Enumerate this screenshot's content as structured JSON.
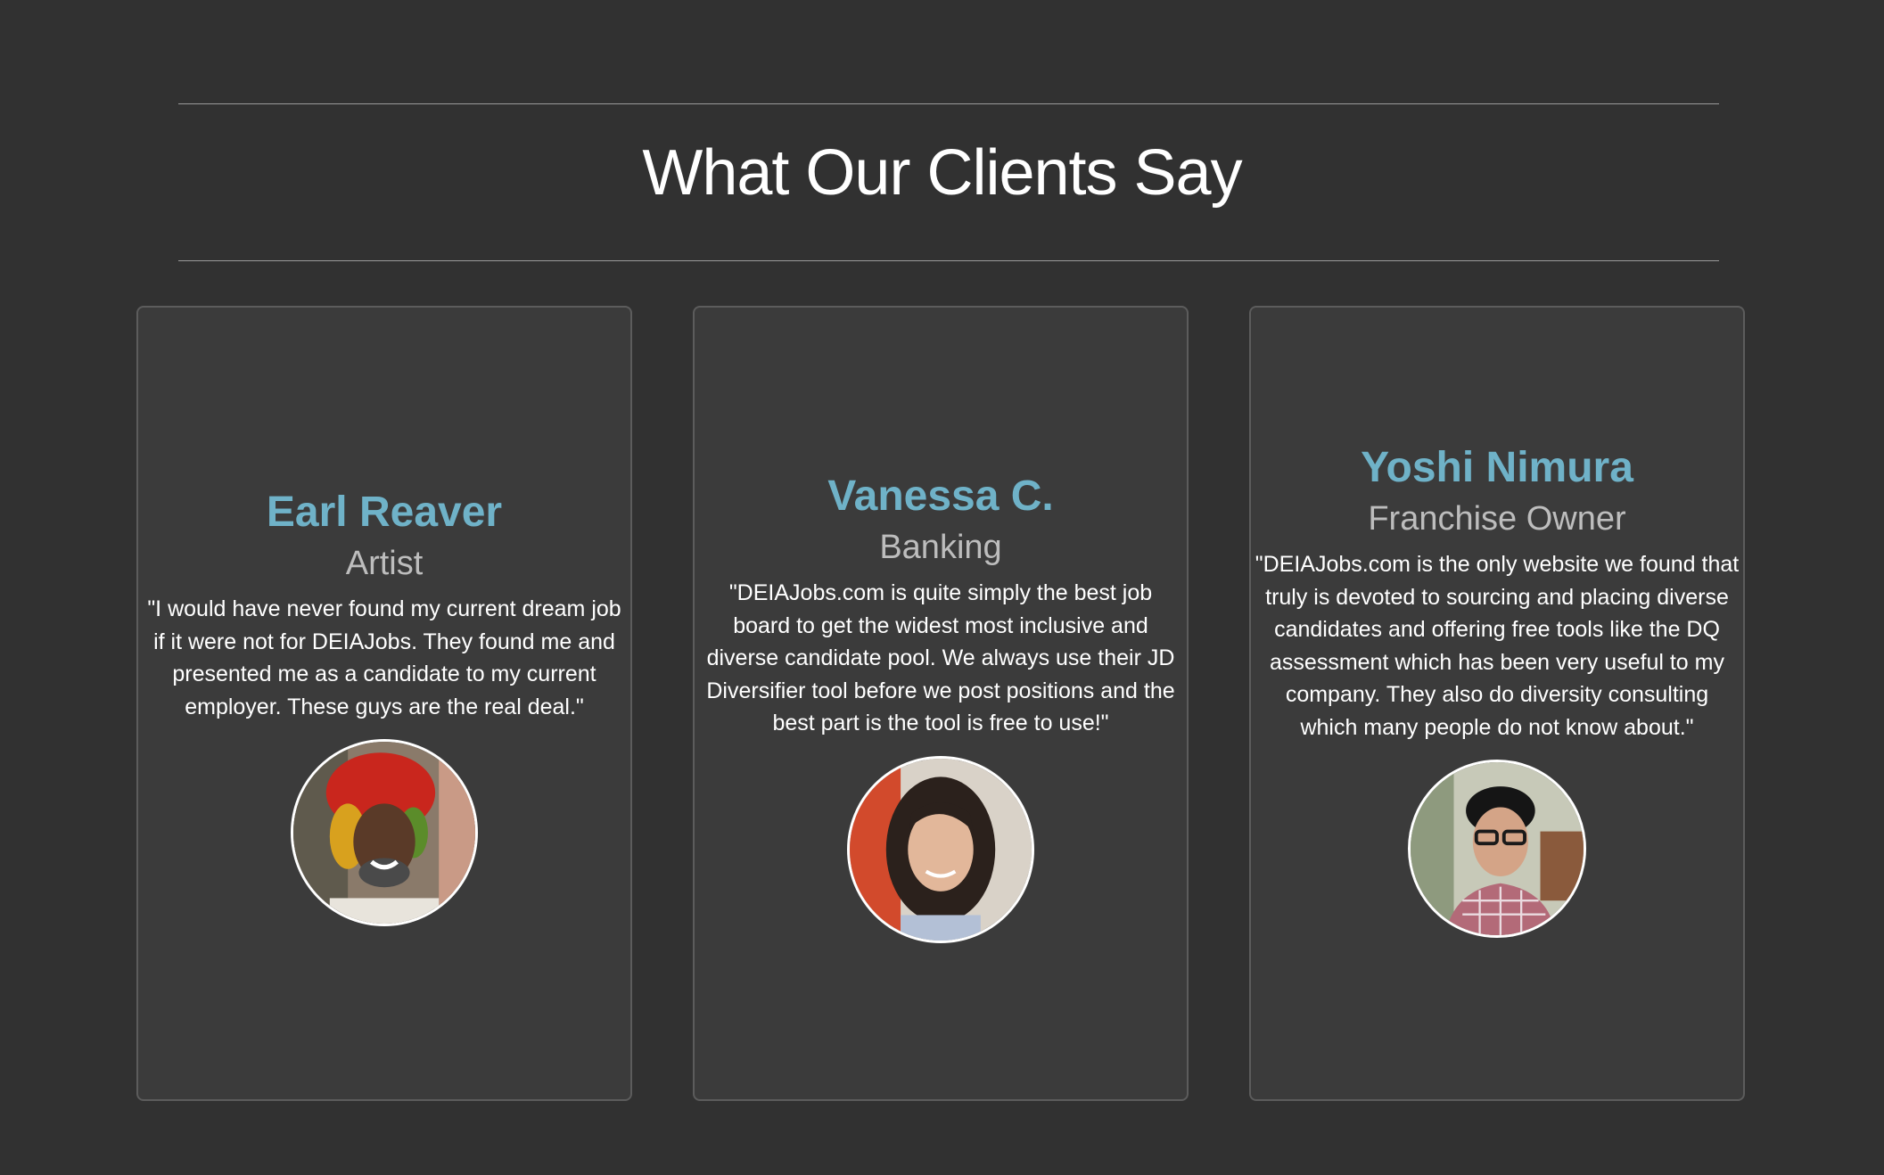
{
  "section": {
    "title": "What Our Clients Say"
  },
  "testimonials": [
    {
      "name": "Earl Reaver",
      "role": "Artist",
      "quote": "\"I would have never found my current dream job if it were not for DEIAJobs. They found me and presented me as a candidate to my current employer. These guys are the real deal.\""
    },
    {
      "name": "Vanessa C.",
      "role": "Banking",
      "quote": "\"DEIAJobs.com is quite simply the best job board to get the widest most inclusive and diverse candidate pool. We always use their JD Diversifier tool before we post positions and the best part is the tool is free to use!\""
    },
    {
      "name": "Yoshi Nimura",
      "role": "Franchise Owner",
      "quote": "\"DEIAJobs.com is the only website we found that truly is devoted to sourcing and placing diverse candidates and offering free tools like the DQ assessment which has been very useful to my company. They also do diversity consulting which many people do not know about.\""
    }
  ],
  "colors": {
    "background": "#313131",
    "card": "#3b3b3b",
    "name_accent": "#6fb2c8"
  }
}
